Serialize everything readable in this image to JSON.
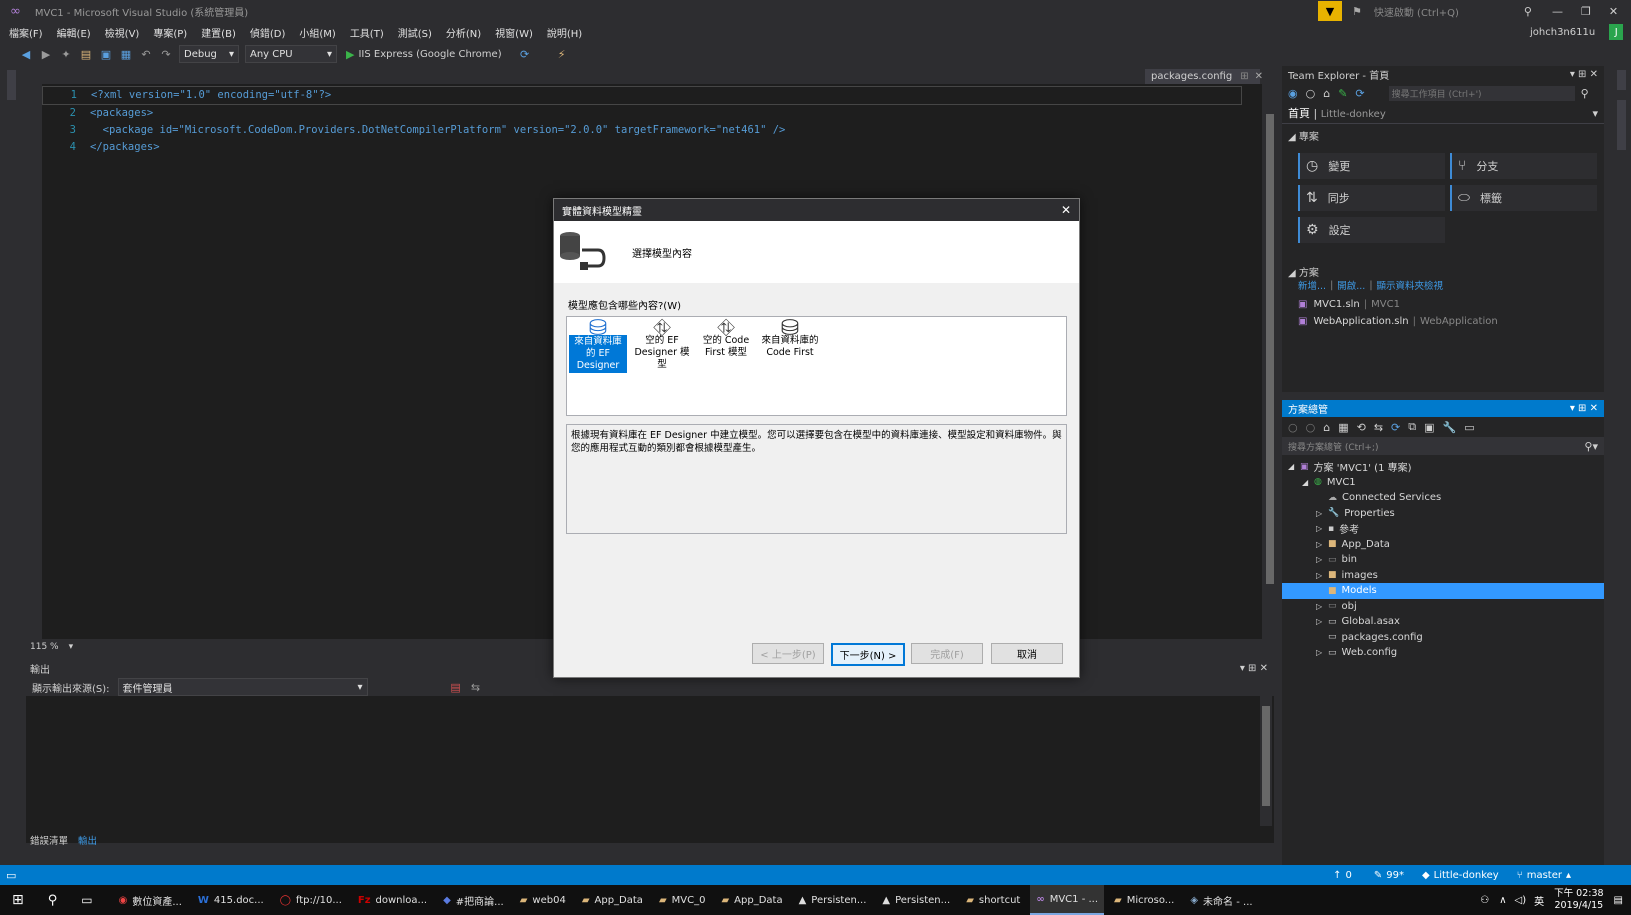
{
  "title_bar": {
    "app_title": "MVC1 - Microsoft Visual Studio (系統管理員)",
    "quick_launch_placeholder": "快速啟動 (Ctrl+Q)",
    "user": "johch3n611u",
    "avatar_letter": "J"
  },
  "menu": [
    "檔案(F)",
    "編輯(E)",
    "檢視(V)",
    "專案(P)",
    "建置(B)",
    "偵錯(D)",
    "小組(M)",
    "工具(T)",
    "測試(S)",
    "分析(N)",
    "視窗(W)",
    "說明(H)"
  ],
  "toolbar": {
    "config": "Debug",
    "platform": "Any CPU",
    "run_target": "IIS Express (Google Chrome)"
  },
  "editor": {
    "tab_label": "packages.config",
    "lines": [
      {
        "n": "1",
        "text": "<?xml version=\"1.0\" encoding=\"utf-8\"?>"
      },
      {
        "n": "2",
        "text": "<packages>"
      },
      {
        "n": "3",
        "text": "  <package id=\"Microsoft.CodeDom.Providers.DotNetCompilerPlatform\" version=\"2.0.0\" targetFramework=\"net461\" />"
      },
      {
        "n": "4",
        "text": "</packages>"
      }
    ],
    "zoom": "115 %"
  },
  "output": {
    "title": "輸出",
    "source_label": "顯示輸出來源(S):",
    "source_value": "套件管理員",
    "tabs": [
      "錯誤清單",
      "輸出"
    ]
  },
  "team_explorer": {
    "title": "Team Explorer - 首頁",
    "search_placeholder": "搜尋工作項目 (Ctrl+')",
    "home": "首頁",
    "repo": "Little-donkey",
    "project_section": "專案",
    "tiles": [
      "變更",
      "分支",
      "同步",
      "標籤",
      "設定"
    ],
    "solutions_section": "方案",
    "solution_links": [
      "新增...",
      "開啟...",
      "顯示資料夾檢視"
    ],
    "solutions": [
      {
        "name": "MVC1.sln",
        "path": "MVC1"
      },
      {
        "name": "WebApplication.sln",
        "path": "WebApplication"
      }
    ]
  },
  "solution_explorer": {
    "title": "方案總管",
    "search_placeholder": "搜尋方案總管 (Ctrl+;)",
    "items": [
      {
        "label": "方案 'MVC1' (1 專案)",
        "indent": 0,
        "selected": false
      },
      {
        "label": "MVC1",
        "indent": 1,
        "selected": false
      },
      {
        "label": "Connected Services",
        "indent": 2,
        "selected": false
      },
      {
        "label": "Properties",
        "indent": 2,
        "selected": false
      },
      {
        "label": "參考",
        "indent": 2,
        "selected": false
      },
      {
        "label": "App_Data",
        "indent": 2,
        "selected": false
      },
      {
        "label": "bin",
        "indent": 2,
        "selected": false
      },
      {
        "label": "images",
        "indent": 2,
        "selected": false
      },
      {
        "label": "Models",
        "indent": 2,
        "selected": true
      },
      {
        "label": "obj",
        "indent": 2,
        "selected": false
      },
      {
        "label": "Global.asax",
        "indent": 2,
        "selected": false
      },
      {
        "label": "packages.config",
        "indent": 2,
        "selected": false
      },
      {
        "label": "Web.config",
        "indent": 2,
        "selected": false
      }
    ]
  },
  "dialog": {
    "title": "實體資料模型精靈",
    "heading": "選擇模型內容",
    "prompt": "模型應包含哪些內容?(W)",
    "choices": [
      "來自資料庫的 EF Designer",
      "空的 EF Designer 模型",
      "空的 Code First 模型",
      "來自資料庫的 Code First"
    ],
    "description": "根據現有資料庫在 EF Designer 中建立模型。您可以選擇要包含在模型中的資料庫連接、模型設定和資料庫物件。與您的應用程式互動的類別都會根據模型產生。",
    "buttons": {
      "prev": "< 上一步(P)",
      "next": "下一步(N) >",
      "finish": "完成(F)",
      "cancel": "取消"
    }
  },
  "status_bar": {
    "up": "0",
    "changes": "99*",
    "repo": "Little-donkey",
    "branch": "master"
  },
  "taskbar": {
    "tasks": [
      "數位資產...",
      "415.doc...",
      "ftp://10...",
      "downloa...",
      "#把商論...",
      "web04",
      "App_Data",
      "MVC_0",
      "App_Data",
      "Persisten...",
      "Persisten...",
      "shortcut",
      "MVC1 - ...",
      "Microso...",
      "未命名 - ..."
    ],
    "lang": "英",
    "time": "下午 02:38",
    "date": "2019/4/15"
  },
  "colors": {
    "accent": "#007acc",
    "selection": "#3399ff",
    "dialog_selection": "#0078d7"
  }
}
